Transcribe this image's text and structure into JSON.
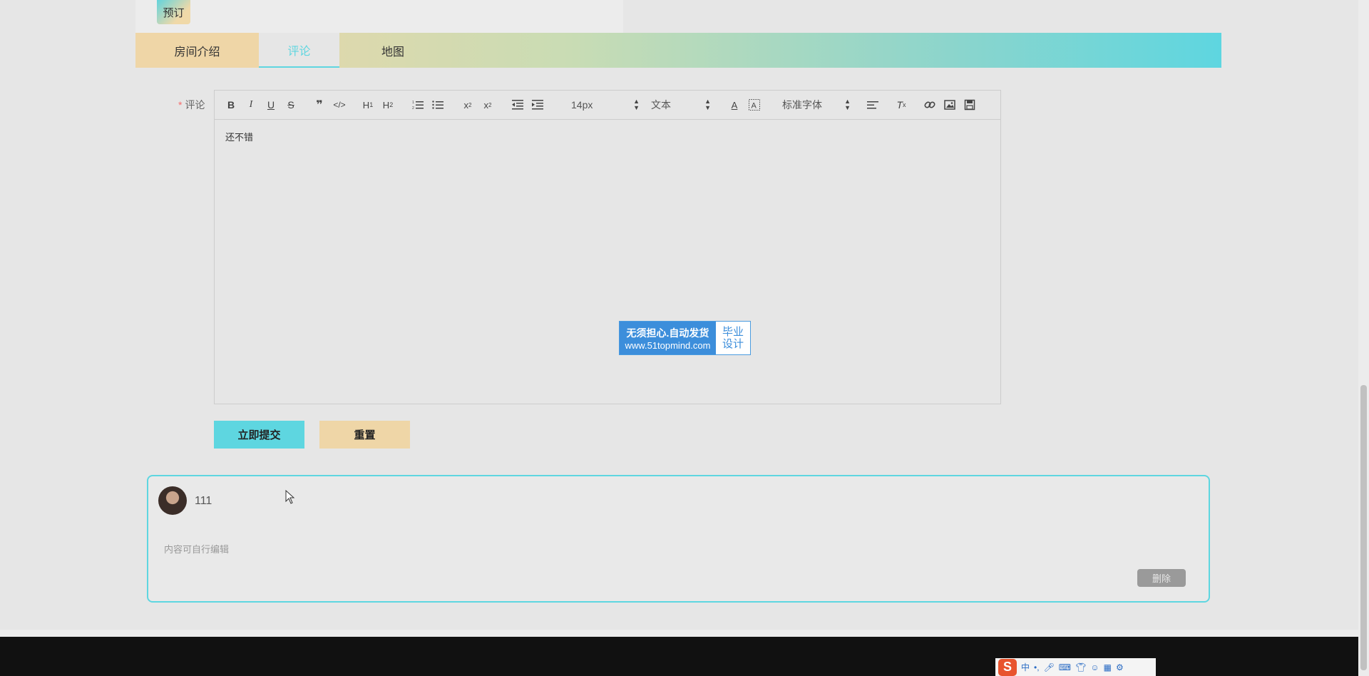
{
  "booking": {
    "label": "预订"
  },
  "tabs": [
    {
      "label": "房间介绍"
    },
    {
      "label": "评论"
    },
    {
      "label": "地图"
    }
  ],
  "form": {
    "label": "评论",
    "required_mark": "*",
    "editor": {
      "font_size": "14px",
      "text_style": "文本",
      "font_family": "标准字体",
      "content": "还不错"
    },
    "submit_label": "立即提交",
    "reset_label": "重置"
  },
  "watermark": {
    "line1": "无须担心.自动发货",
    "line2": "www.51topmind.com",
    "right1": "毕业",
    "right2": "设计"
  },
  "comment": {
    "username": "111",
    "text": "内容可自行编辑",
    "delete_label": "删除"
  },
  "ime": {
    "mode": "中",
    "punct": "•,"
  },
  "colors": {
    "accent": "#5ed6e0",
    "secondary": "#efd6a7"
  }
}
